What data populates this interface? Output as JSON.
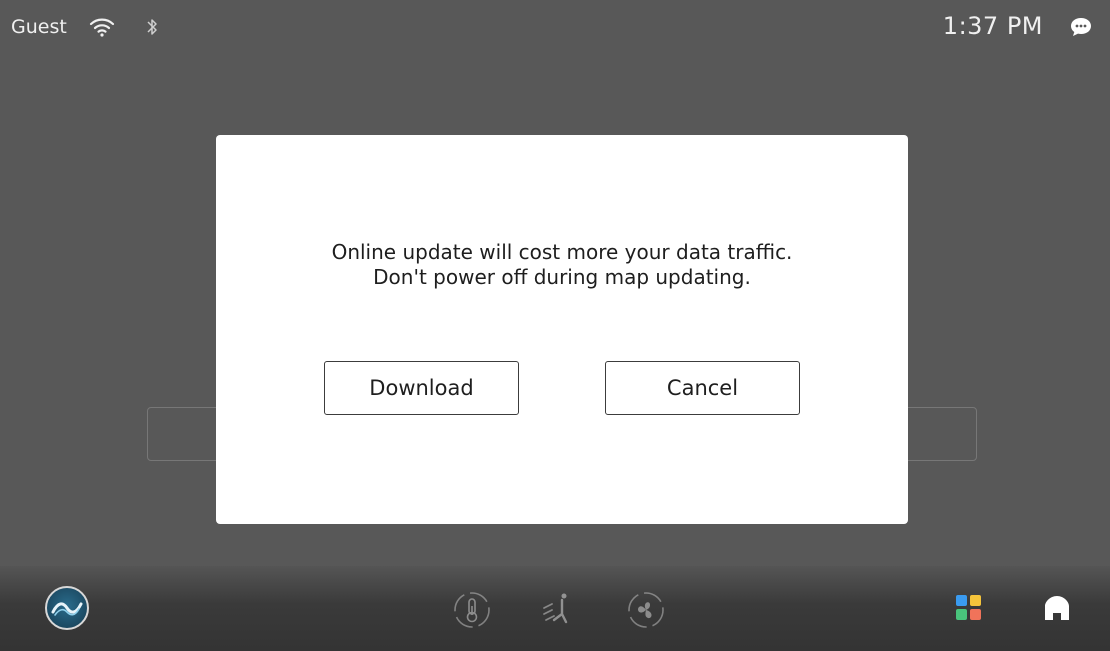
{
  "status_bar": {
    "user": "Guest",
    "time": "1:37 PM",
    "icons": [
      "wifi-icon",
      "bluetooth-icon",
      "message-icon"
    ]
  },
  "dialog": {
    "message_lines": [
      "Online update will cost more your data traffic.",
      "Don't power off during map updating."
    ],
    "download_label": "Download",
    "cancel_label": "Cancel"
  },
  "dock": {
    "icons": [
      "brand-logo-icon",
      "temperature-icon",
      "airflow-seat-icon",
      "fan-icon",
      "apps-grid-icon",
      "home-icon"
    ]
  },
  "colors": {
    "background": "#585858",
    "dialog": "#ffffff",
    "apps_blue": "#3a9bf0",
    "apps_yellow": "#f5c43b",
    "apps_green": "#49c47c",
    "apps_red": "#f0735a"
  }
}
